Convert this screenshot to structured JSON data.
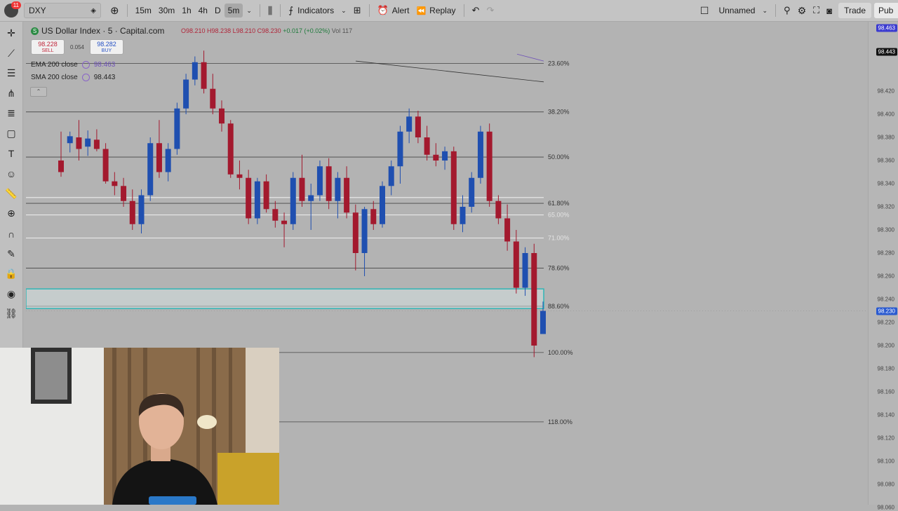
{
  "toolbar": {
    "notification_count": "11",
    "symbol": "DXY",
    "timeframes": [
      "15m",
      "30m",
      "1h",
      "4h",
      "D",
      "5m"
    ],
    "active_timeframe": "5m",
    "indicators_label": "Indicators",
    "alert_label": "Alert",
    "replay_label": "Replay",
    "layout_name": "Unnamed",
    "trade_label": "Trade",
    "publish_label": "Pub"
  },
  "legend": {
    "symbol_icon": "S",
    "title": "US Dollar Index · 5 · Capital.com",
    "ohlc": {
      "o": "O98.210",
      "h": "H98.238",
      "l": "L98.210",
      "c": "C98.230",
      "change": "+0.017 (+0.02%)",
      "vol": "Vol 117"
    },
    "sell_price": "98.228",
    "sell_label": "SELL",
    "spread": "0.054",
    "buy_price": "98.282",
    "buy_label": "BUY",
    "ema_label": "EMA 200 close",
    "ema_value": "98.463",
    "sma_label": "SMA 200 close",
    "sma_value": "98.443"
  },
  "colors": {
    "up": "#1f4fb0",
    "down": "#a3192e",
    "fib_line": "#444444",
    "zone": "#26b5b5",
    "ema": "#6f52b8",
    "sma": "#333333"
  },
  "price_scale": {
    "ticks": [
      "98.420",
      "98.400",
      "98.380",
      "98.360",
      "98.340",
      "98.320",
      "98.300",
      "98.280",
      "98.260",
      "98.240",
      "98.220",
      "98.200",
      "98.180",
      "98.160",
      "98.140",
      "98.120",
      "98.100",
      "98.080",
      "98.060"
    ],
    "ema_tag": "98.463",
    "sma_tag": "98.443",
    "last_price_tag": "98.230"
  },
  "fib_levels": [
    {
      "label": "23.60%",
      "price": 98.444
    },
    {
      "label": "38.20%",
      "price": 98.402
    },
    {
      "label": "50.00%",
      "price": 98.363
    },
    {
      "label": "61.80%",
      "price": 98.323
    },
    {
      "label": "65.00%",
      "price": 98.313
    },
    {
      "label": "71.00%",
      "price": 98.293
    },
    {
      "label": "78.60%",
      "price": 98.267
    },
    {
      "label": "88.60%",
      "price": 98.234
    },
    {
      "label": "100.00%",
      "price": 98.194
    },
    {
      "label": "118.00%",
      "price": 98.134
    }
  ],
  "zone": {
    "top": 98.249,
    "bottom": 98.232
  },
  "candles": [
    {
      "o": 98.36,
      "h": 98.385,
      "l": 98.346,
      "c": 98.35
    },
    {
      "o": 98.375,
      "h": 98.385,
      "l": 98.367,
      "c": 98.381
    },
    {
      "o": 98.38,
      "h": 98.395,
      "l": 98.36,
      "c": 98.37
    },
    {
      "o": 98.372,
      "h": 98.386,
      "l": 98.364,
      "c": 98.379
    },
    {
      "o": 98.378,
      "h": 98.387,
      "l": 98.368,
      "c": 98.37
    },
    {
      "o": 98.37,
      "h": 98.375,
      "l": 98.34,
      "c": 98.342
    },
    {
      "o": 98.342,
      "h": 98.35,
      "l": 98.33,
      "c": 98.338
    },
    {
      "o": 98.338,
      "h": 98.345,
      "l": 98.32,
      "c": 98.325
    },
    {
      "o": 98.325,
      "h": 98.335,
      "l": 98.3,
      "c": 98.305
    },
    {
      "o": 98.305,
      "h": 98.335,
      "l": 98.297,
      "c": 98.33
    },
    {
      "o": 98.33,
      "h": 98.38,
      "l": 98.325,
      "c": 98.375
    },
    {
      "o": 98.375,
      "h": 98.395,
      "l": 98.345,
      "c": 98.35
    },
    {
      "o": 98.35,
      "h": 98.375,
      "l": 98.342,
      "c": 98.37
    },
    {
      "o": 98.37,
      "h": 98.41,
      "l": 98.365,
      "c": 98.405
    },
    {
      "o": 98.405,
      "h": 98.435,
      "l": 98.4,
      "c": 98.43
    },
    {
      "o": 98.43,
      "h": 98.45,
      "l": 98.425,
      "c": 98.445
    },
    {
      "o": 98.445,
      "h": 98.455,
      "l": 98.418,
      "c": 98.422
    },
    {
      "o": 98.422,
      "h": 98.435,
      "l": 98.4,
      "c": 98.405
    },
    {
      "o": 98.405,
      "h": 98.412,
      "l": 98.385,
      "c": 98.392
    },
    {
      "o": 98.392,
      "h": 98.395,
      "l": 98.345,
      "c": 98.348
    },
    {
      "o": 98.348,
      "h": 98.36,
      "l": 98.335,
      "c": 98.345
    },
    {
      "o": 98.345,
      "h": 98.352,
      "l": 98.305,
      "c": 98.31
    },
    {
      "o": 98.31,
      "h": 98.345,
      "l": 98.305,
      "c": 98.342
    },
    {
      "o": 98.342,
      "h": 98.348,
      "l": 98.315,
      "c": 98.318
    },
    {
      "o": 98.318,
      "h": 98.325,
      "l": 98.302,
      "c": 98.308
    },
    {
      "o": 98.308,
      "h": 98.315,
      "l": 98.285,
      "c": 98.305
    },
    {
      "o": 98.305,
      "h": 98.35,
      "l": 98.3,
      "c": 98.345
    },
    {
      "o": 98.345,
      "h": 98.365,
      "l": 98.32,
      "c": 98.325
    },
    {
      "o": 98.325,
      "h": 98.34,
      "l": 98.3,
      "c": 98.33
    },
    {
      "o": 98.33,
      "h": 98.36,
      "l": 98.325,
      "c": 98.355
    },
    {
      "o": 98.355,
      "h": 98.362,
      "l": 98.318,
      "c": 98.325
    },
    {
      "o": 98.325,
      "h": 98.35,
      "l": 98.31,
      "c": 98.345
    },
    {
      "o": 98.345,
      "h": 98.355,
      "l": 98.31,
      "c": 98.315
    },
    {
      "o": 98.315,
      "h": 98.322,
      "l": 98.265,
      "c": 98.28
    },
    {
      "o": 98.28,
      "h": 98.32,
      "l": 98.26,
      "c": 98.318
    },
    {
      "o": 98.318,
      "h": 98.325,
      "l": 98.3,
      "c": 98.305
    },
    {
      "o": 98.305,
      "h": 98.342,
      "l": 98.302,
      "c": 98.338
    },
    {
      "o": 98.338,
      "h": 98.36,
      "l": 98.33,
      "c": 98.355
    },
    {
      "o": 98.355,
      "h": 98.39,
      "l": 98.34,
      "c": 98.385
    },
    {
      "o": 98.385,
      "h": 98.405,
      "l": 98.375,
      "c": 98.398
    },
    {
      "o": 98.398,
      "h": 98.403,
      "l": 98.375,
      "c": 98.38
    },
    {
      "o": 98.38,
      "h": 98.39,
      "l": 98.36,
      "c": 98.365
    },
    {
      "o": 98.365,
      "h": 98.375,
      "l": 98.355,
      "c": 98.36
    },
    {
      "o": 98.36,
      "h": 98.372,
      "l": 98.352,
      "c": 98.368
    },
    {
      "o": 98.368,
      "h": 98.372,
      "l": 98.3,
      "c": 98.305
    },
    {
      "o": 98.305,
      "h": 98.33,
      "l": 98.298,
      "c": 98.32
    },
    {
      "o": 98.32,
      "h": 98.35,
      "l": 98.315,
      "c": 98.345
    },
    {
      "o": 98.345,
      "h": 98.39,
      "l": 98.34,
      "c": 98.385
    },
    {
      "o": 98.385,
      "h": 98.392,
      "l": 98.32,
      "c": 98.325
    },
    {
      "o": 98.325,
      "h": 98.33,
      "l": 98.305,
      "c": 98.31
    },
    {
      "o": 98.31,
      "h": 98.322,
      "l": 98.282,
      "c": 98.29
    },
    {
      "o": 98.29,
      "h": 98.3,
      "l": 98.245,
      "c": 98.25
    },
    {
      "o": 98.25,
      "h": 98.285,
      "l": 98.243,
      "c": 98.28
    },
    {
      "o": 98.28,
      "h": 98.288,
      "l": 98.19,
      "c": 98.2
    },
    {
      "o": 98.21,
      "h": 98.238,
      "l": 98.21,
      "c": 98.23
    }
  ]
}
